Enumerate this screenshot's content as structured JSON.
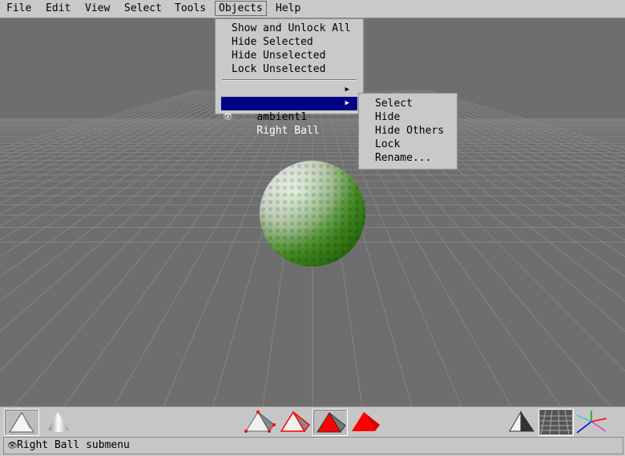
{
  "menubar": {
    "items": [
      "File",
      "Edit",
      "View",
      "Select",
      "Tools",
      "Objects",
      "Help"
    ],
    "open_item": "Objects"
  },
  "objects_menu": {
    "items": [
      {
        "label": "Show and Unlock All"
      },
      {
        "label": "Hide Selected"
      },
      {
        "label": "Hide Unselected"
      },
      {
        "label": "Lock Unselected"
      }
    ],
    "objects": [
      {
        "label": "ambient1",
        "icon": "eye-icon",
        "has_submenu": true,
        "selected": false
      },
      {
        "label": "Right Ball",
        "icon": "eye-icon",
        "has_submenu": true,
        "selected": true
      }
    ]
  },
  "submenu": {
    "items": [
      "Select",
      "Hide",
      "Hide Others",
      "Lock",
      "Rename..."
    ]
  },
  "toolbar": {
    "buttons": [
      {
        "name": "flat-shade-mode",
        "icon": "white-pyramid-icon",
        "pressed": true
      },
      {
        "name": "smooth-shade-mode",
        "icon": "smooth-cone-icon",
        "pressed": false
      },
      {
        "name": "vertex-select-mode",
        "icon": "pyramid-vertices-icon",
        "pressed": false
      },
      {
        "name": "edge-select-mode",
        "icon": "pyramid-edges-icon",
        "pressed": false
      },
      {
        "name": "face-select-mode",
        "icon": "pyramid-face-icon",
        "pressed": true
      },
      {
        "name": "body-select-mode",
        "icon": "red-body-icon",
        "pressed": false
      },
      {
        "name": "toggle-shading",
        "icon": "two-tone-pyramid-icon",
        "pressed": false
      },
      {
        "name": "toggle-ground-grid",
        "icon": "ground-grid-icon",
        "pressed": true
      },
      {
        "name": "toggle-axes",
        "icon": "axes-icon",
        "pressed": false
      }
    ]
  },
  "status": {
    "text": "Right Ball submenu",
    "icon": "eye-icon"
  },
  "colors": {
    "menu_bg": "#c9c9c9",
    "selection": "#000084",
    "viewport_bg": "#6e6e6e",
    "accent_red": "#ff0000"
  }
}
